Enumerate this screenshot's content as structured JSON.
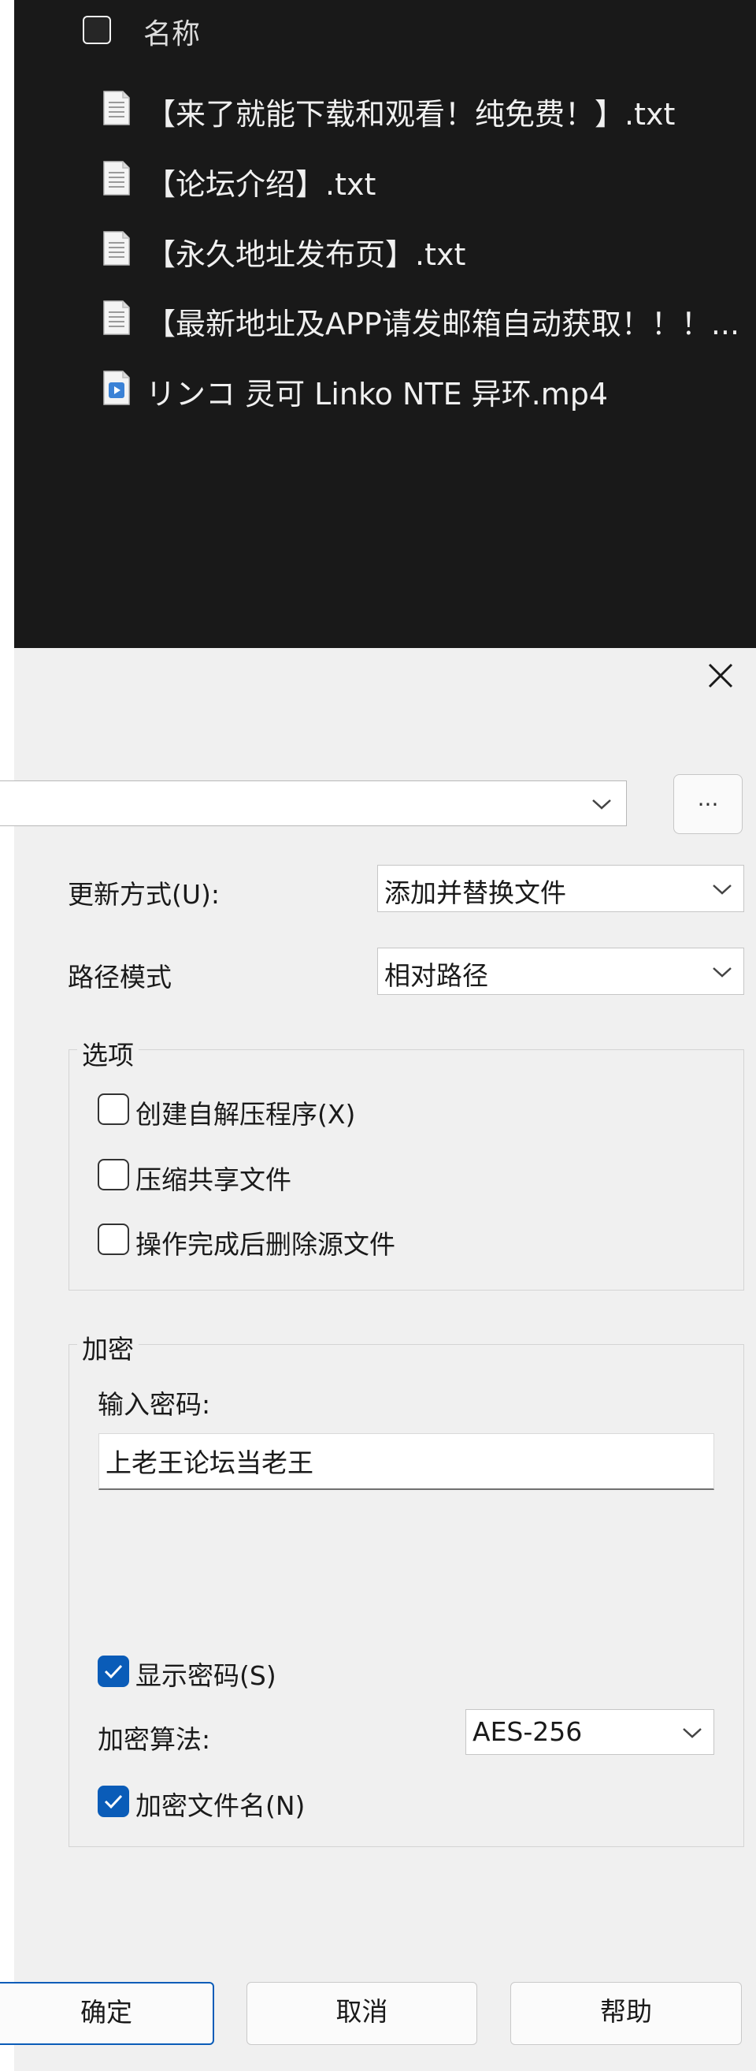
{
  "explorer": {
    "header_name": "名称",
    "files": [
      {
        "name": "【来了就能下载和观看！纯免费！】.txt",
        "icon": "text-file-icon"
      },
      {
        "name": "【论坛介绍】.txt",
        "icon": "text-file-icon"
      },
      {
        "name": "【永久地址发布页】.txt",
        "icon": "text-file-icon"
      },
      {
        "name": "【最新地址及APP请发邮箱自动获取！！！...",
        "icon": "text-file-icon"
      },
      {
        "name": "リンコ 灵可 Linko NTE 异环.mp4",
        "icon": "video-file-icon"
      }
    ]
  },
  "dialog": {
    "browse_label": "...",
    "update_mode_label": "更新方式(U):",
    "update_mode_value": "添加并替换文件",
    "path_mode_label": "路径模式",
    "path_mode_value": "相对路径",
    "options": {
      "title": "选项",
      "create_sfx": {
        "label": "创建自解压程序(X)",
        "checked": false
      },
      "compress_shared": {
        "label": "压缩共享文件",
        "checked": false
      },
      "delete_after": {
        "label": "操作完成后删除源文件",
        "checked": false
      }
    },
    "encryption": {
      "title": "加密",
      "password_label": "输入密码:",
      "password_value": "上老王论坛当老王",
      "show_password": {
        "label": "显示密码(S)",
        "checked": true
      },
      "method_label": "加密算法:",
      "method_value": "AES-256",
      "encrypt_names": {
        "label": "加密文件名(N)",
        "checked": true
      }
    },
    "buttons": {
      "ok": "确定",
      "cancel": "取消",
      "help": "帮助"
    }
  },
  "colors": {
    "explorer_bg": "#191919",
    "dialog_bg": "#f0f0f0",
    "accent": "#0a5cb8"
  }
}
